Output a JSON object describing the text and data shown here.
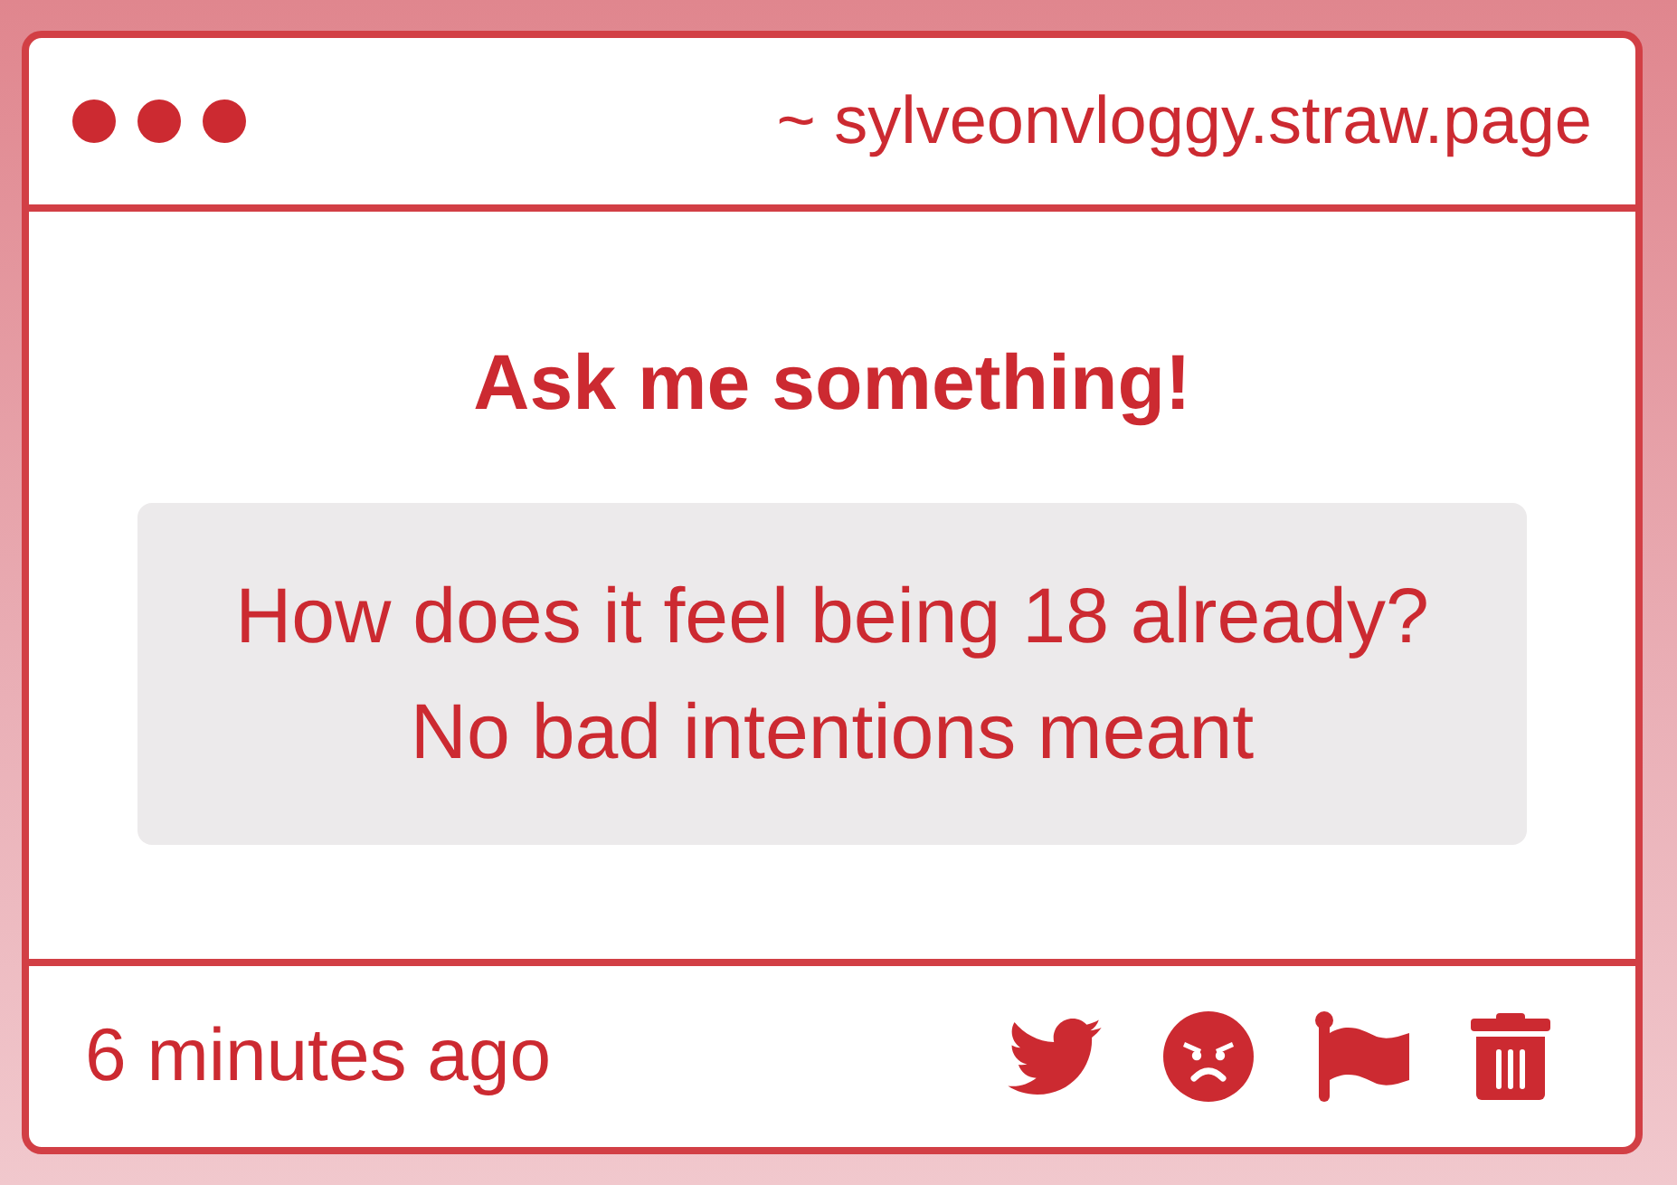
{
  "window": {
    "title": "~ sylveonvloggy.straw.page"
  },
  "prompt": {
    "heading": "Ask me something!",
    "question": "How does it feel being 18 already?\nNo bad intentions meant"
  },
  "footer": {
    "time": "6 minutes ago"
  }
}
